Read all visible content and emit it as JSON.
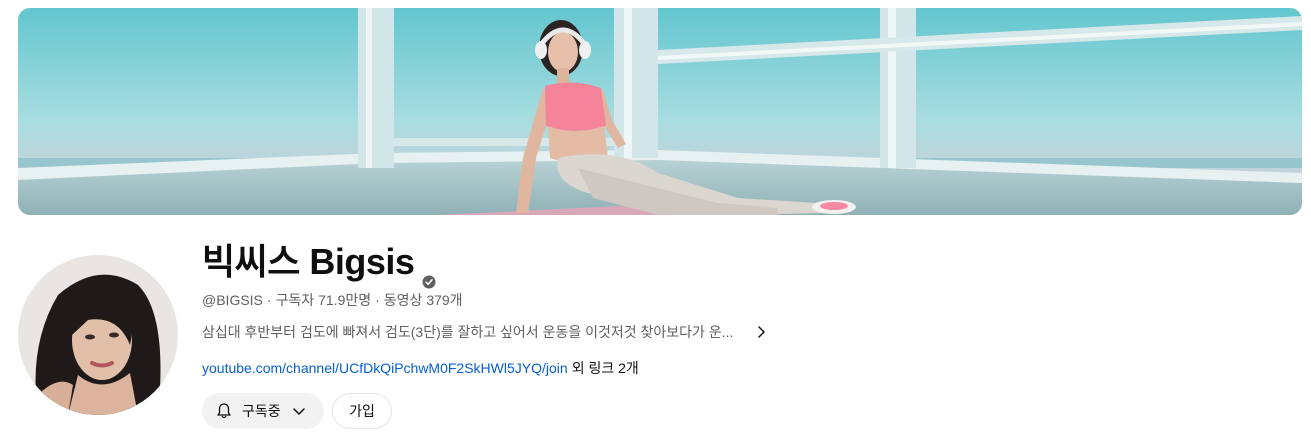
{
  "channel": {
    "name": "빅씨스 Bigsis",
    "verified": true,
    "handle": "@BIGSIS",
    "subscribers": "구독자 71.9만명",
    "videos": "동영상 379개",
    "separator": "·",
    "description": "삼십대 후반부터 검도에 빠져서 검도(3단)를 잘하고 싶어서 운동을 이것저것 찾아보다가 운...",
    "link": "youtube.com/channel/UCfDkQiPchwM0F2SkHWl5JYQ/join",
    "more_links": "외 링크 2개"
  },
  "actions": {
    "subscribe_label": "구독중",
    "join_label": "가입"
  },
  "icons": {
    "verified": "verified-check-icon",
    "bell": "bell-icon",
    "chevron_down": "chevron-down-icon",
    "chevron_right": "chevron-right-icon"
  },
  "colors": {
    "link": "#065fd4",
    "secondary_text": "#606060",
    "button_bg": "#f2f2f2"
  }
}
